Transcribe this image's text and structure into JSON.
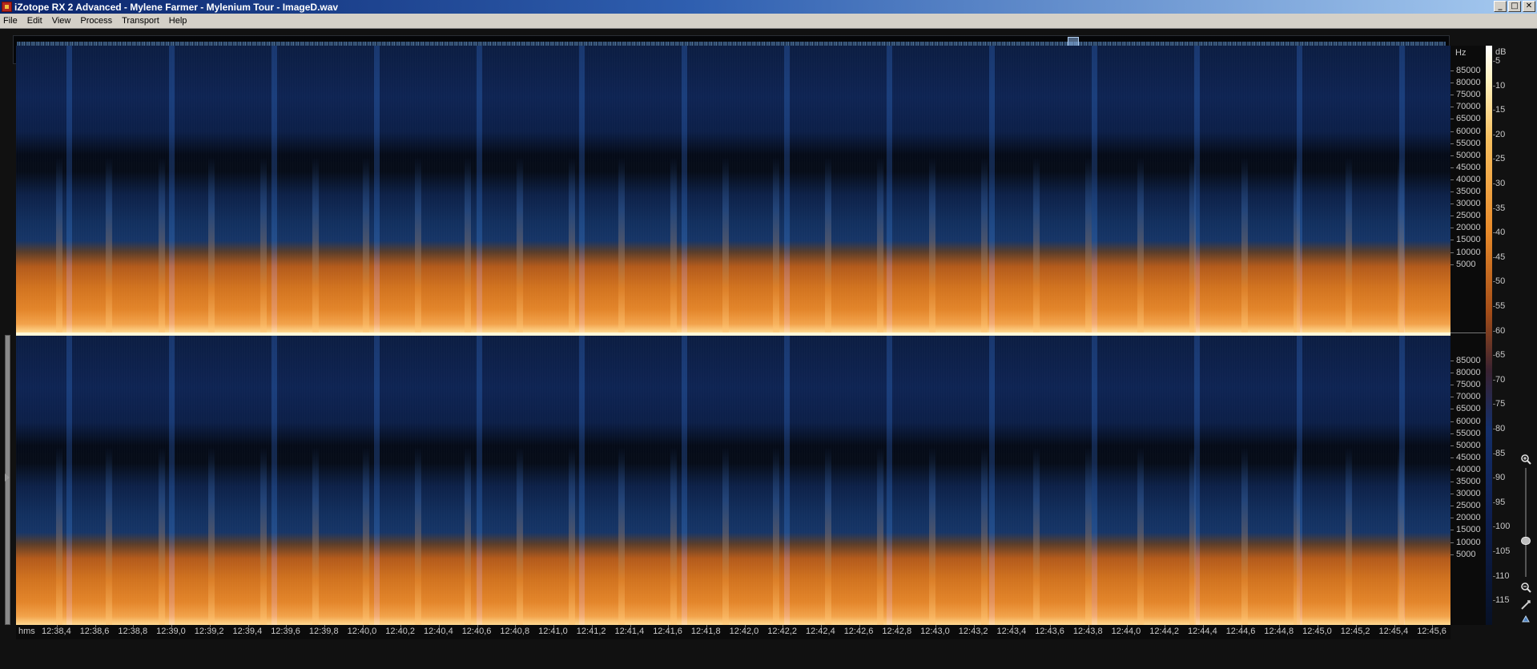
{
  "window": {
    "title": "iZotope RX 2 Advanced - Mylene Farmer - Mylenium Tour - ImageD.wav",
    "controls": {
      "minimize": "_",
      "maximize": "□",
      "close": "✕"
    }
  },
  "menu": [
    {
      "label": "File"
    },
    {
      "label": "Edit"
    },
    {
      "label": "View"
    },
    {
      "label": "Process"
    },
    {
      "label": "Transport"
    },
    {
      "label": "Help"
    }
  ],
  "frequency_axis": {
    "unit": "Hz",
    "ticks": [
      "85000",
      "80000",
      "75000",
      "70000",
      "65000",
      "60000",
      "55000",
      "50000",
      "45000",
      "40000",
      "35000",
      "30000",
      "25000",
      "20000",
      "15000",
      "10000",
      "5000"
    ]
  },
  "db_scale": {
    "unit": "dB",
    "ticks": [
      "5",
      "10",
      "15",
      "20",
      "25",
      "30",
      "35",
      "40",
      "45",
      "50",
      "55",
      "60",
      "65",
      "70",
      "75",
      "80",
      "85",
      "90",
      "95",
      "100",
      "105",
      "110",
      "115"
    ]
  },
  "time_axis": {
    "unit": "hms",
    "ticks": [
      "12:38,4",
      "12:38,6",
      "12:38,8",
      "12:39,0",
      "12:39,2",
      "12:39,4",
      "12:39,6",
      "12:39,8",
      "12:40,0",
      "12:40,2",
      "12:40,4",
      "12:40,6",
      "12:40,8",
      "12:41,0",
      "12:41,2",
      "12:41,4",
      "12:41,6",
      "12:41,8",
      "12:42,0",
      "12:42,2",
      "12:42,4",
      "12:42,6",
      "12:42,8",
      "12:43,0",
      "12:43,2",
      "12:43,4",
      "12:43,6",
      "12:43,8",
      "12:44,0",
      "12:44,2",
      "12:44,4",
      "12:44,6",
      "12:44,8",
      "12:45,0",
      "12:45,2",
      "12:45,4",
      "12:45,6"
    ]
  },
  "colors": {
    "spectrogram_low": "#0e2453",
    "spectrogram_high": "#e3852a",
    "titlebar": "#0a246a",
    "menubar": "#d4d0c8"
  },
  "icons": {
    "zoom_in": "zoom-in-icon",
    "zoom_out": "zoom-out-icon",
    "app": "app-icon"
  }
}
